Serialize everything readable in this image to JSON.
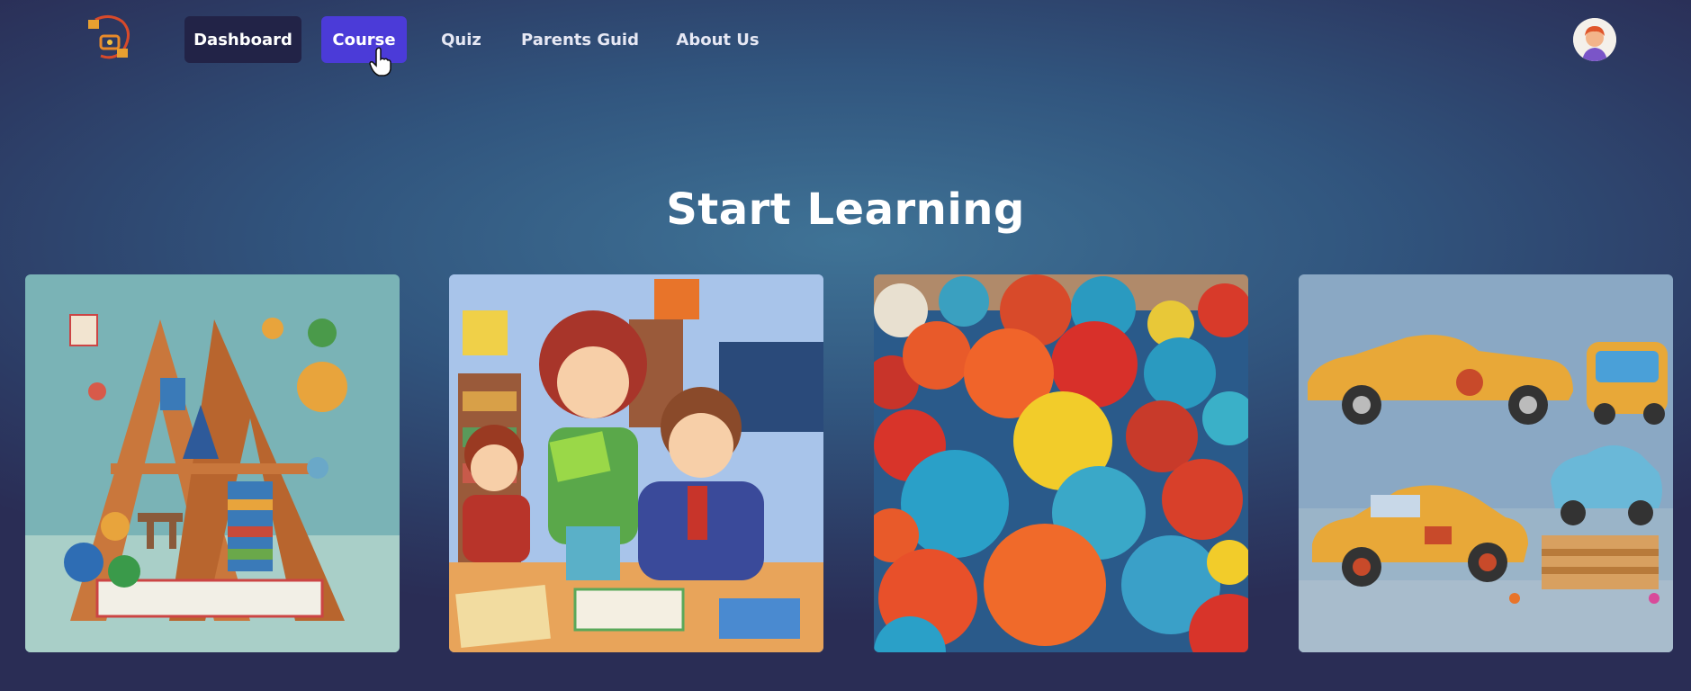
{
  "nav": {
    "items": [
      {
        "label": "Dashboard",
        "state": "active"
      },
      {
        "label": "Course",
        "state": "hover"
      },
      {
        "label": "Quiz"
      },
      {
        "label": "Parents Guid"
      },
      {
        "label": "About Us"
      }
    ]
  },
  "icons": {
    "logo": "kids-learning-logo-icon",
    "cursor": "hand-pointer-icon",
    "avatar": "user-avatar-icon"
  },
  "hero": {
    "title": "Start Learning"
  },
  "cards": [
    {
      "name": "alphabet-letters-image"
    },
    {
      "name": "kids-classroom-reading-image"
    },
    {
      "name": "colorful-balls-image"
    },
    {
      "name": "toy-cars-image"
    }
  ],
  "colors": {
    "nav_active_bg": "#222347",
    "nav_hover_bg": "#4b3bd8",
    "bg_center": "#3f7396",
    "bg_edge": "#2a2d55"
  }
}
